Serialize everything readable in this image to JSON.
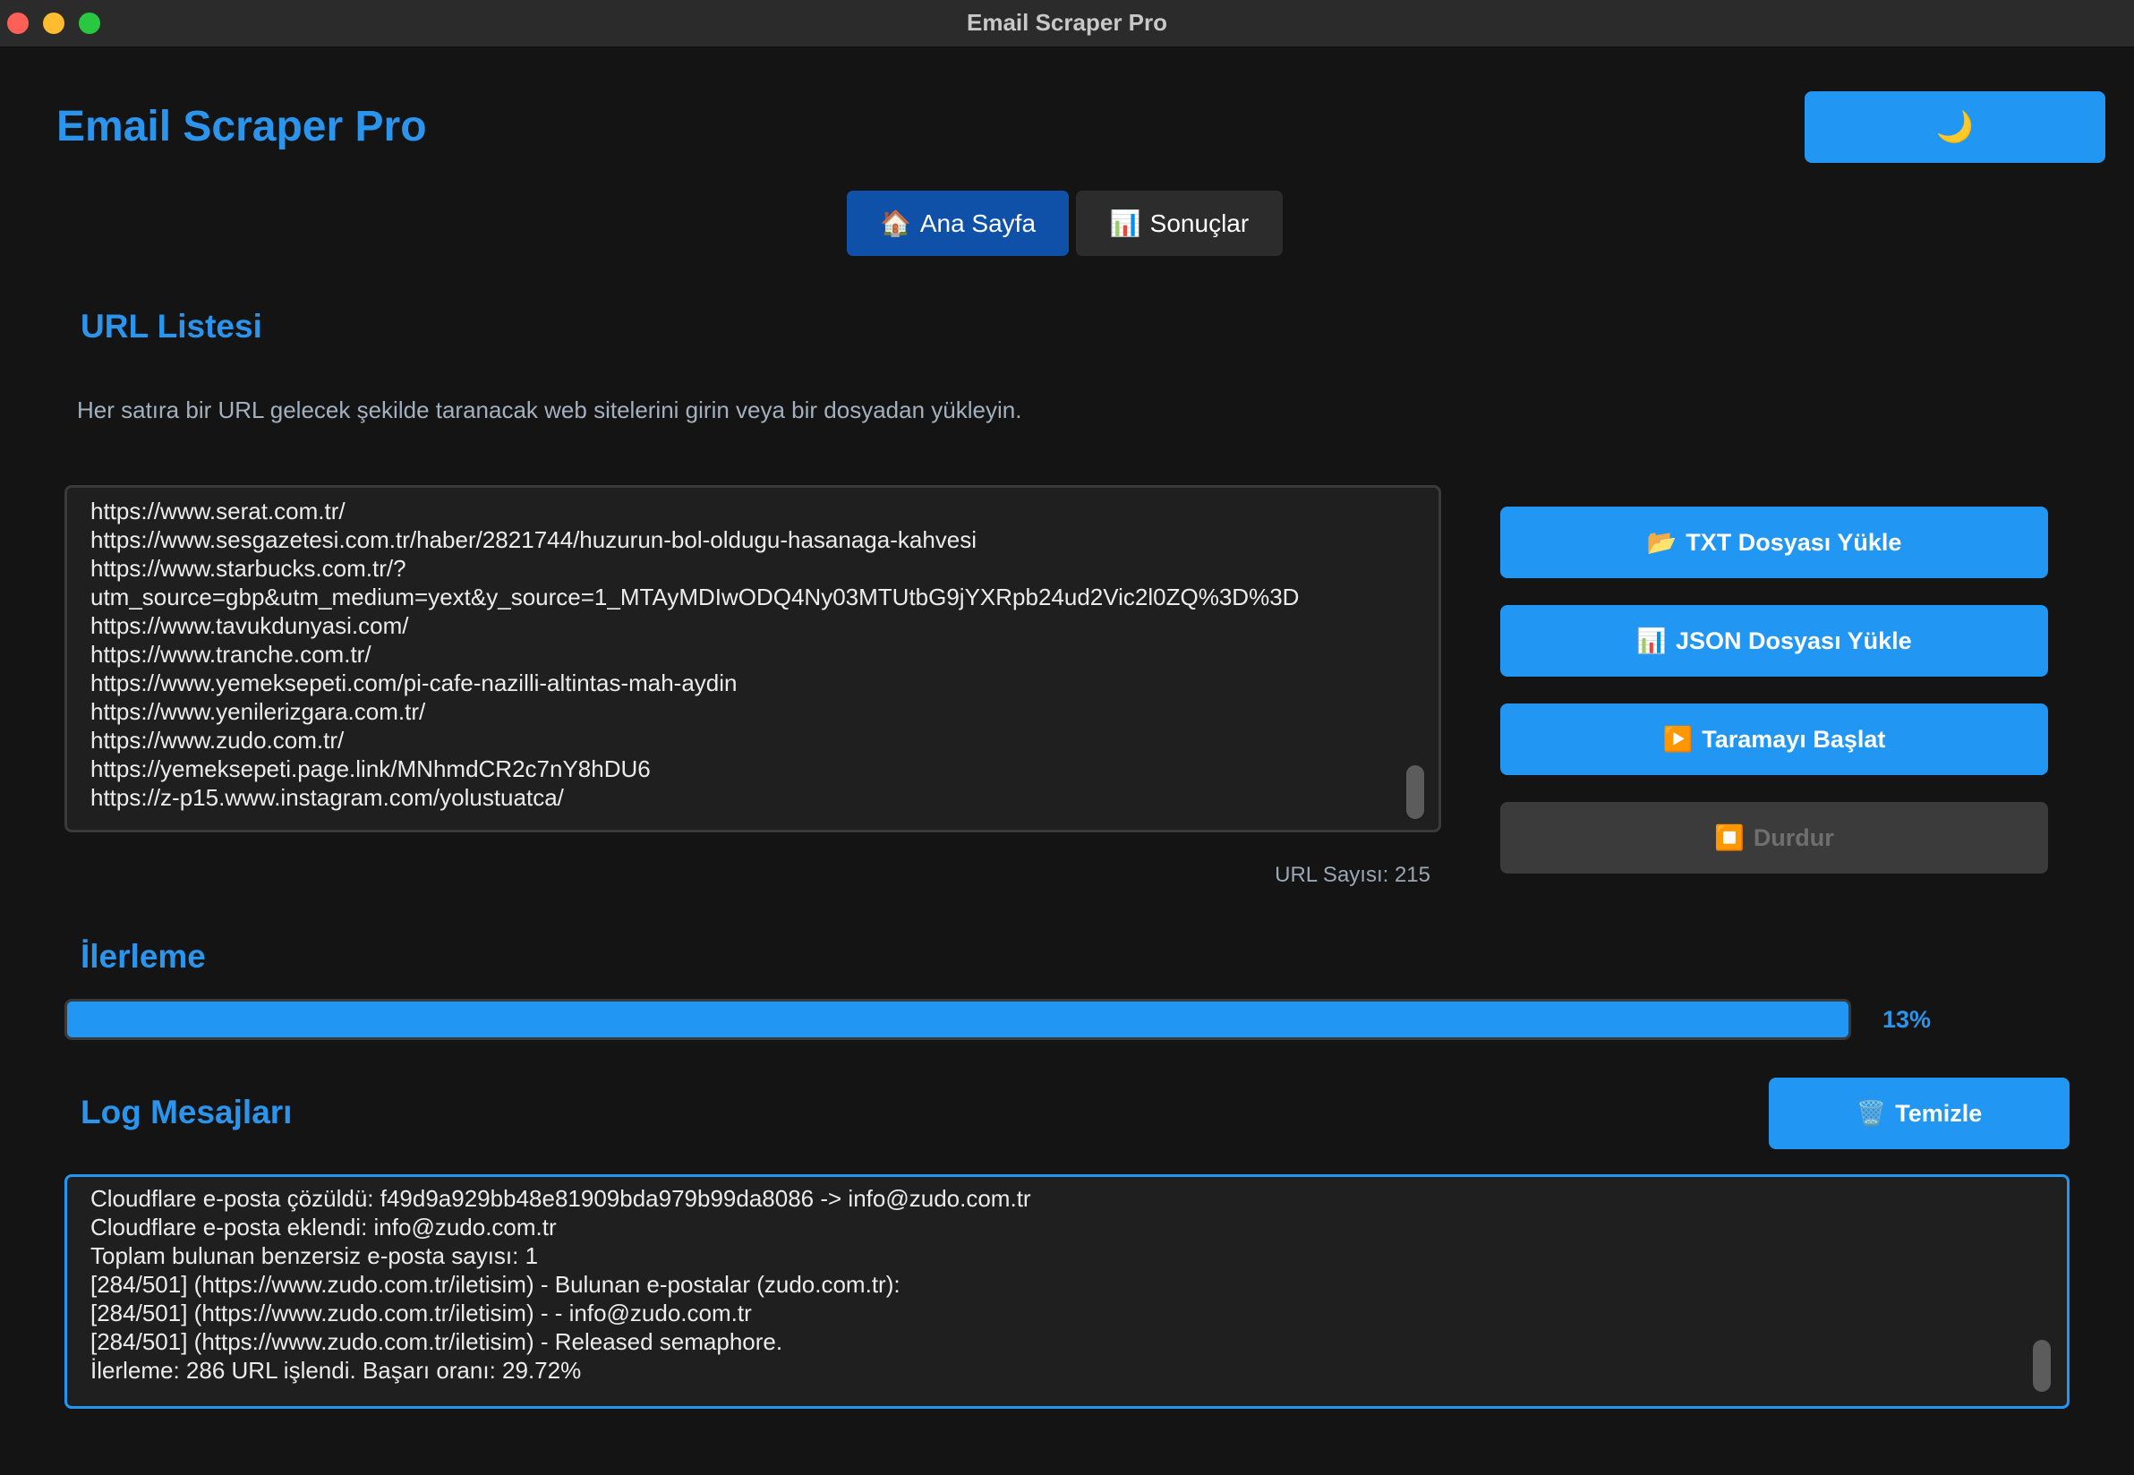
{
  "window": {
    "title": "Email Scraper Pro"
  },
  "header": {
    "app_title": "Email Scraper Pro",
    "theme_toggle_icon": "moon-icon",
    "theme_toggle_glyph": "🌙"
  },
  "tabs": [
    {
      "label": "Ana Sayfa",
      "icon": "home-icon",
      "glyph": "🏠",
      "active": true
    },
    {
      "label": "Sonuçlar",
      "icon": "bar-chart-icon",
      "glyph": "📊",
      "active": false
    }
  ],
  "url_section": {
    "title": "URL Listesi",
    "description": "Her satıra bir URL gelecek şekilde taranacak web sitelerini girin veya bir dosyadan yükleyin.",
    "lines": [
      "https://www.serat.com.tr/",
      "https://www.sesgazetesi.com.tr/haber/2821744/huzurun-bol-oldugu-hasanaga-kahvesi",
      "https://www.starbucks.com.tr/?",
      "utm_source=gbp&utm_medium=yext&y_source=1_MTAyMDIwODQ4Ny03MTUtbG9jYXRpb24ud2Vic2l0ZQ%3D%3D",
      "https://www.tavukdunyasi.com/",
      "https://www.tranche.com.tr/",
      "https://www.yemeksepeti.com/pi-cafe-nazilli-altintas-mah-aydin",
      "https://www.yenilerizgara.com.tr/",
      "https://www.zudo.com.tr/",
      "https://yemeksepeti.page.link/MNhmdCR2c7nY8hDU6",
      "https://z-p15.www.instagram.com/yolustuatca/"
    ],
    "url_count_label": "URL Sayısı: 215"
  },
  "actions": {
    "load_txt": {
      "label": "TXT Dosyası Yükle",
      "glyph": "📂"
    },
    "load_json": {
      "label": "JSON Dosyası Yükle",
      "glyph": "📊"
    },
    "start_scan": {
      "label": "Taramayı Başlat",
      "glyph": "▶️"
    },
    "stop": {
      "label": "Durdur",
      "glyph": "⏹️"
    }
  },
  "progress": {
    "title": "İlerleme",
    "percent_label": "13%",
    "bar_fill_percent": 100
  },
  "log": {
    "title": "Log Mesajları",
    "clear": {
      "label": "Temizle",
      "glyph": "🗑️"
    },
    "lines": [
      "Cloudflare e-posta çözüldü: f49d9a929bb48e81909bda979b99da8086 -> info@zudo.com.tr",
      "Cloudflare e-posta eklendi: info@zudo.com.tr",
      "Toplam bulunan benzersiz e-posta sayısı: 1",
      "[284/501] (https://www.zudo.com.tr/iletisim) - Bulunan e-postalar (zudo.com.tr):",
      "[284/501] (https://www.zudo.com.tr/iletisim) - - info@zudo.com.tr",
      "[284/501] (https://www.zudo.com.tr/iletisim) - Released semaphore.",
      "İlerleme: 286 URL işlendi. Başarı oranı: 29.72%"
    ]
  },
  "colors": {
    "accent": "#2196f3",
    "accent_text": "#2b95ee",
    "active_tab": "#0f51a8",
    "background": "#141414"
  }
}
